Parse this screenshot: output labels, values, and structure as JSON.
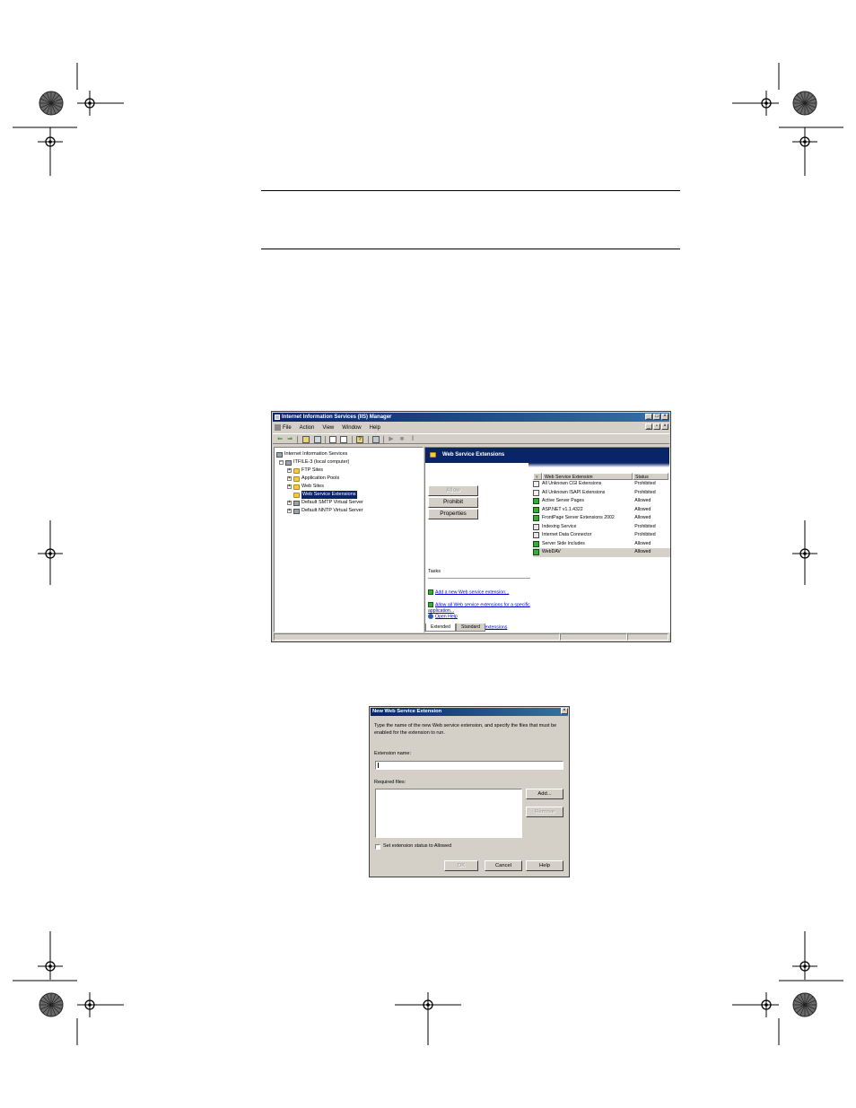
{
  "iis_window": {
    "title": "Internet Information Services (IIS) Manager",
    "menu": [
      "File",
      "Action",
      "View",
      "Window",
      "Help"
    ],
    "tree": {
      "root": "Internet Information Services",
      "computer": "ITFILE-3 (local computer)",
      "children": [
        "FTP Sites",
        "Application Pools",
        "Web Sites",
        "Web Service Extensions",
        "Default SMTP Virtual Server",
        "Default NNTP Virtual Server"
      ]
    },
    "panel_title": "Web Service Extensions",
    "buttons": {
      "allow": "Allow",
      "prohibit": "Prohibit",
      "properties": "Properties"
    },
    "tasks_label": "Tasks",
    "tasks": [
      "Add a new Web service extension...",
      "Allow all Web service extensions for a specific application...",
      "Prohibit all Web service extensions",
      "Open Help"
    ],
    "columns": {
      "extension": "Web Service Extension",
      "status": "Status"
    },
    "rows": [
      {
        "name": "All Unknown CGI Extensions",
        "status": "Prohibited",
        "icon": "filter-icon"
      },
      {
        "name": "All Unknown ISAPI Extensions",
        "status": "Prohibited",
        "icon": "filter-icon"
      },
      {
        "name": "Active Server Pages",
        "status": "Allowed",
        "icon": "extension-allowed-icon"
      },
      {
        "name": "ASP.NET v1.1.4322",
        "status": "Allowed",
        "icon": "extension-allowed-icon"
      },
      {
        "name": "FrontPage Server Extensions 2002",
        "status": "Allowed",
        "icon": "extension-allowed-icon"
      },
      {
        "name": "Indexing Service",
        "status": "Prohibited",
        "icon": "extension-prohibited-icon"
      },
      {
        "name": "Internet Data Connector",
        "status": "Prohibited",
        "icon": "extension-prohibited-icon"
      },
      {
        "name": "Server Side Includes",
        "status": "Allowed",
        "icon": "extension-allowed-icon"
      },
      {
        "name": "WebDAV",
        "status": "Allowed",
        "icon": "extension-allowed-icon"
      }
    ],
    "tabs": [
      "Extended",
      "Standard"
    ]
  },
  "dialog": {
    "title": "New Web Service Extension",
    "instruction": "Type the name of the new Web service extension, and specify the files that must be enabled for the extension to run.",
    "extension_name_label": "Extension name:",
    "extension_name_value": "",
    "required_files_label": "Required files:",
    "add_button": "Add...",
    "remove_button": "Remove",
    "checkbox_label": "Set extension status to Allowed",
    "ok_button": "OK",
    "cancel_button": "Cancel",
    "help_button": "Help"
  }
}
